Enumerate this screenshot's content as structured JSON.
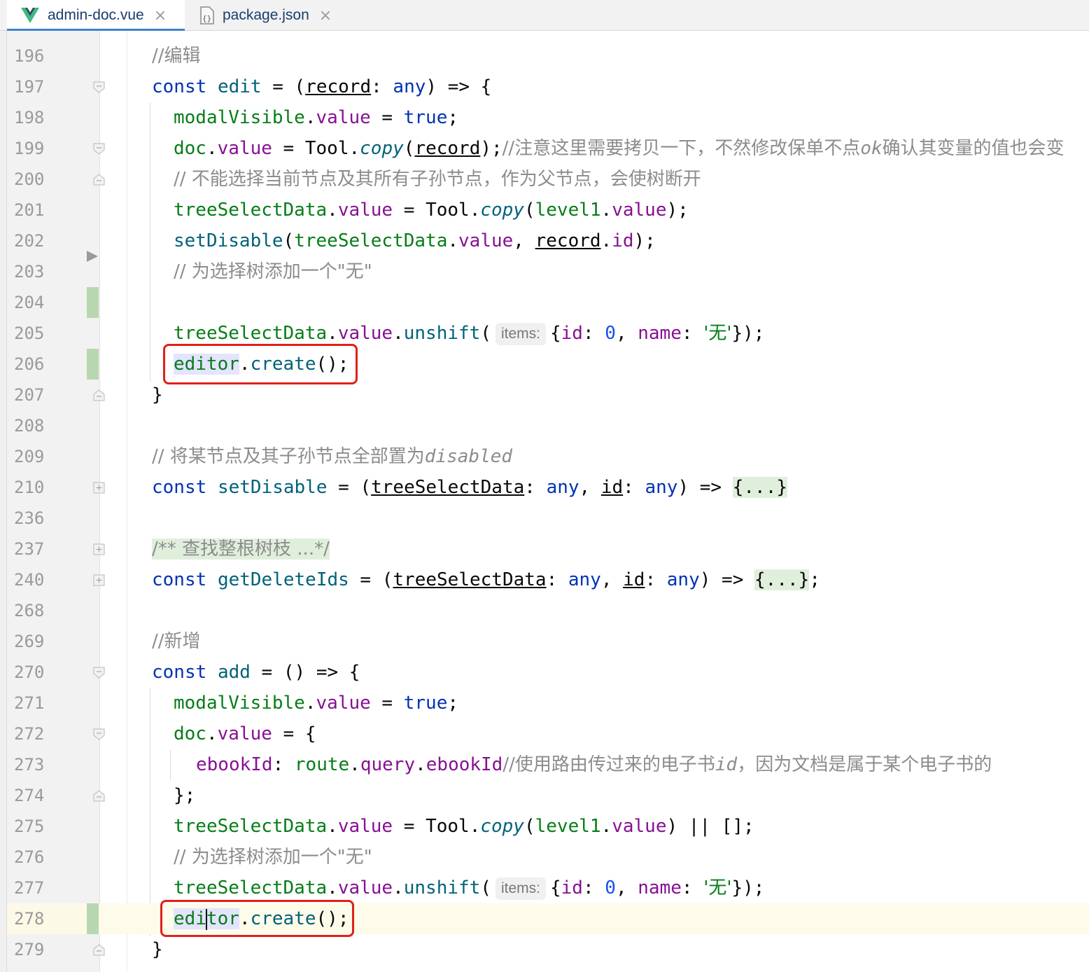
{
  "tabs": [
    {
      "label": "admin-doc.vue",
      "icon": "vue-icon",
      "active": true
    },
    {
      "label": "package.json",
      "icon": "json-file-icon",
      "active": false
    }
  ],
  "close_glyph": "×",
  "lines": [
    {
      "n": "196",
      "t": "//编辑"
    },
    {
      "n": "197",
      "t": "const edit = (record: any) => {"
    },
    {
      "n": "198",
      "t": "modalVisible.value = true;"
    },
    {
      "n": "199",
      "t": "doc.value = Tool.copy(record);//注意这里需要拷贝一下，不然修改保单不点ok确认其变量的值也会变"
    },
    {
      "n": "200",
      "t": "// 不能选择当前节点及其所有子孙节点，作为父节点，会使树断开"
    },
    {
      "n": "201",
      "t": "treeSelectData.value = Tool.copy(level1.value);"
    },
    {
      "n": "202",
      "t": "setDisable(treeSelectData.value, record.id);"
    },
    {
      "n": "203",
      "t": "// 为选择树添加一个\"无\""
    },
    {
      "n": "204",
      "t": ""
    },
    {
      "n": "205",
      "t": "treeSelectData.value.unshift( items: {id: 0, name: '无'});"
    },
    {
      "n": "206",
      "t": "editor.create();"
    },
    {
      "n": "207",
      "t": "}"
    },
    {
      "n": "208",
      "t": ""
    },
    {
      "n": "209",
      "t": "// 将某节点及其子孙节点全部置为disabled"
    },
    {
      "n": "210",
      "t": "const setDisable = (treeSelectData: any, id: any) => {...}"
    },
    {
      "n": "236",
      "t": ""
    },
    {
      "n": "237",
      "t": "/** 查找整根树枝 ...*/"
    },
    {
      "n": "240",
      "t": "const getDeleteIds = (treeSelectData: any, id: any) => {...};"
    },
    {
      "n": "268",
      "t": ""
    },
    {
      "n": "269",
      "t": "//新增"
    },
    {
      "n": "270",
      "t": "const add = () => {"
    },
    {
      "n": "271",
      "t": "modalVisible.value = true;"
    },
    {
      "n": "272",
      "t": "doc.value = {"
    },
    {
      "n": "273",
      "t": "ebookId: route.query.ebookId//使用路由传过来的电子书id，因为文档是属于某个电子书的"
    },
    {
      "n": "274",
      "t": "};"
    },
    {
      "n": "275",
      "t": "treeSelectData.value = Tool.copy(level1.value) || [];"
    },
    {
      "n": "276",
      "t": "// 为选择树添加一个\"无\""
    },
    {
      "n": "277",
      "t": "treeSelectData.value.unshift( items: {id: 0, name: '无'});"
    },
    {
      "n": "278",
      "t": "editor.create();"
    },
    {
      "n": "279",
      "t": "}"
    }
  ],
  "tokens": {
    "c_edit": "//编辑",
    "kw_const": "const",
    "edit": "edit",
    "eq": " = ",
    "record": "record",
    "colon": ": ",
    "any": "any",
    "arrow": ") => {",
    "lp": "(",
    "modalVisible": "modalVisible",
    "dot": ".",
    "value": "value",
    "true": "true",
    "semi": ";",
    "doc": "doc",
    "Tool": "Tool",
    "copy": "copy",
    "c199": "//注意这里需要拷贝一下，不然修改保单不点",
    "c199_ok": "ok",
    "c199_b": "确认其变量的值也会变",
    "c200": "// 不能选择当前节点及其所有子孙节点，作为父节点，会使树断开",
    "treeSelectData": "treeSelectData",
    "level1": "level1",
    "setDisable": "setDisable",
    "id": "id",
    "c203": "// 为选择树添加一个\"无\"",
    "unshift": "unshift",
    "hint_items": "items:",
    "lb": "{",
    "zero": "0",
    "name": "name",
    "wu": "'无'",
    "editor": "editor",
    "create": "create",
    "create_tail": "();",
    "rb": "}",
    "c209": "// 将某节点及其子孙节点全部置为",
    "c209_d": "disabled",
    "fold_body": "{...}",
    "doc_fold": "/** 查找整根树枝 ...*/",
    "getDeleteIds": "getDeleteIds",
    "c_add": "//新增",
    "add": "add",
    "ebookId": "ebookId",
    "route": "route",
    "query": "query",
    "c273": "//使用路由传过来的电子书",
    "c273_id": "id",
    "c273_b": "，因为文档是属于某个电子书的",
    "or_empty": " || [];"
  }
}
